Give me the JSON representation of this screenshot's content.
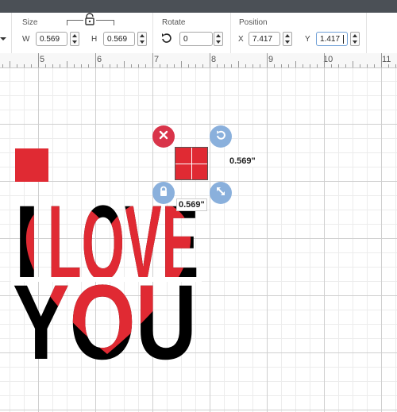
{
  "toolbar": {
    "size": {
      "label": "Size",
      "w_label": "W",
      "w_value": "0.569",
      "h_label": "H",
      "h_value": "0.569"
    },
    "rotate": {
      "label": "Rotate",
      "value": "0"
    },
    "position": {
      "label": "Position",
      "x_label": "X",
      "x_value": "7.417",
      "y_label": "Y",
      "y_value": "1.417"
    }
  },
  "ruler": {
    "numbers": [
      "5",
      "6",
      "7",
      "8",
      "9",
      "10",
      "11"
    ]
  },
  "canvas": {
    "design_text": [
      "I",
      "LOVE",
      "YOU"
    ],
    "selection": {
      "width_label": "0.569\"",
      "height_label": "0.569\""
    },
    "colors": {
      "red": "#e02a33",
      "black": "#000000",
      "delete_handle": "#d9344a",
      "blue_handle": "#8ab0dc"
    }
  }
}
